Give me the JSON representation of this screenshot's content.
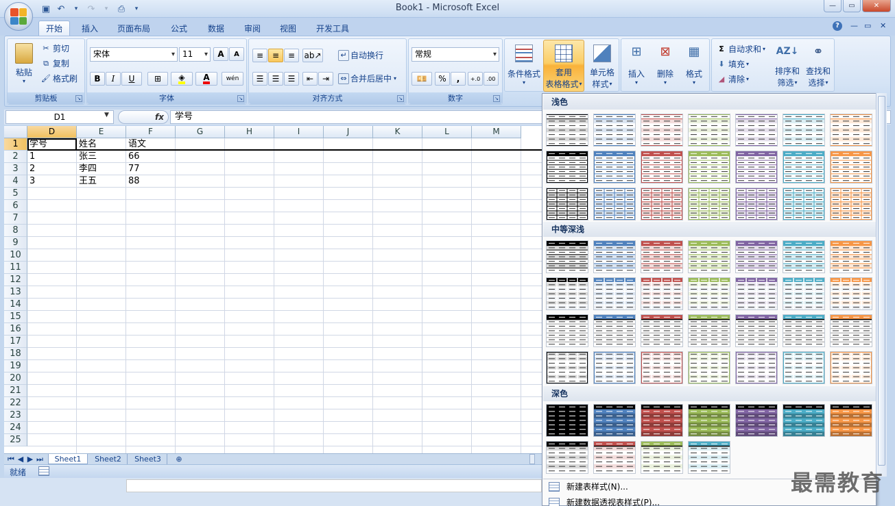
{
  "window": {
    "title": "Book1 - Microsoft Excel"
  },
  "tabs": [
    "开始",
    "插入",
    "页面布局",
    "公式",
    "数据",
    "审阅",
    "视图",
    "开发工具"
  ],
  "clipboard": {
    "paste": "粘贴",
    "cut": "剪切",
    "copy": "复制",
    "format_painter": "格式刷",
    "label": "剪贴板"
  },
  "font": {
    "name": "宋体",
    "size": "11",
    "grow": "A",
    "shrink": "A",
    "bold": "B",
    "italic": "I",
    "underline": "U",
    "color_glyph": "A",
    "phonetic": "wén",
    "label": "字体"
  },
  "alignment": {
    "wrap": "自动换行",
    "merge": "合并后居中",
    "label": "对齐方式"
  },
  "number": {
    "format": "常规",
    "percent": "%",
    "comma": ",",
    "inc": "+.0",
    "dec": ".00",
    "label": "数字"
  },
  "styles": {
    "conditional": "条件格式",
    "table_line1": "套用",
    "table_line2": "表格格式",
    "cell_line1": "单元格",
    "cell_line2": "样式"
  },
  "cells": {
    "insert": "插入",
    "delete": "删除",
    "format": "格式"
  },
  "editing": {
    "autosum": "自动求和",
    "fill": "填充",
    "clear": "清除",
    "sort_line1": "排序和",
    "sort_line2": "筛选",
    "find_line1": "查找和",
    "find_line2": "选择"
  },
  "formula_bar": {
    "name_box": "D1",
    "fx": "fx",
    "value": "学号"
  },
  "sheet": {
    "columns": [
      "D",
      "E",
      "F",
      "G",
      "H",
      "I",
      "J",
      "K",
      "L",
      "M"
    ],
    "rows": [
      "1",
      "2",
      "3",
      "4",
      "5",
      "6",
      "7",
      "8",
      "9",
      "10",
      "11",
      "12",
      "13",
      "14",
      "15",
      "16",
      "17",
      "18",
      "19",
      "20",
      "21",
      "22",
      "23",
      "24",
      "25"
    ],
    "data": [
      [
        "学号",
        "姓名",
        "语文"
      ],
      [
        "1",
        "张三",
        "66"
      ],
      [
        "2",
        "李四",
        "77"
      ],
      [
        "3",
        "王五",
        "88"
      ]
    ]
  },
  "sheet_tabs": [
    "Sheet1",
    "Sheet2",
    "Sheet3"
  ],
  "status": {
    "ready": "就绪"
  },
  "gallery": {
    "sections": [
      "浅色",
      "中等深浅",
      "深色"
    ],
    "palette": [
      "#000000",
      "#4f81bd",
      "#c0504d",
      "#9bbb59",
      "#8064a2",
      "#4bacc6",
      "#f79646"
    ],
    "light_tints": [
      "#d9d9d9",
      "#dbe5f1",
      "#f2dcdb",
      "#ebf1de",
      "#e5e0ec",
      "#dbeef3",
      "#fde9d9"
    ],
    "menu": [
      "新建表样式(N)...",
      "新建数据透视表样式(P)..."
    ]
  },
  "watermark": "最需教育"
}
